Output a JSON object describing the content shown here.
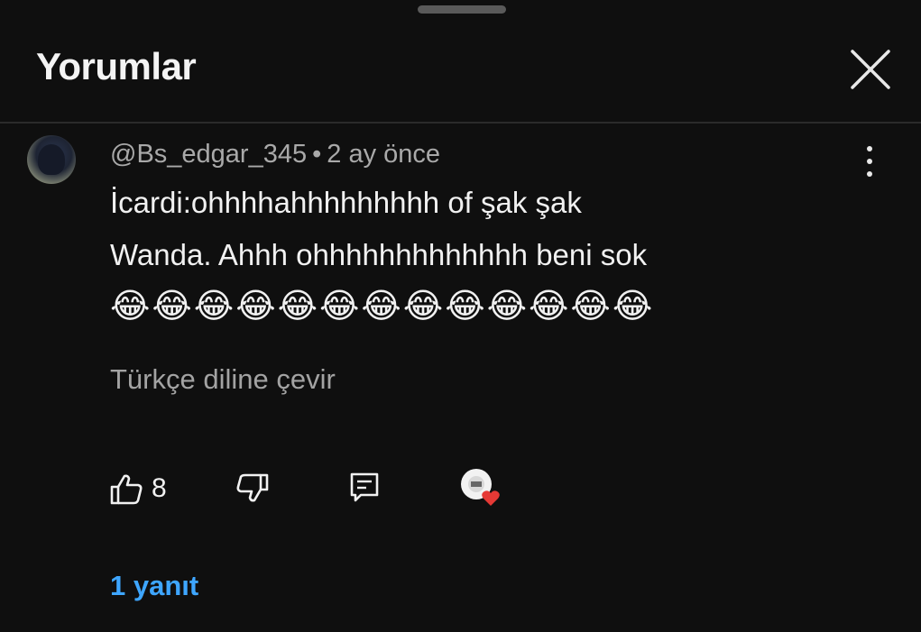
{
  "header": {
    "title": "Yorumlar",
    "close_icon": "close-icon"
  },
  "comment": {
    "author": "@Bs_edgar_345",
    "separator": "•",
    "time": "2 ay önce",
    "line1": "İcardi:ohhhhahhhhhhhhh of şak şak",
    "line2": "Wanda. Ahhh ohhhhhhhhhhhhh beni sok",
    "emojis": "😂😂😂😂😂😂😂😂😂😂😂😂😂",
    "translate_label": "Türkçe diline çevir",
    "like_count": "8",
    "replies_label": "1 yanıt"
  },
  "colors": {
    "background": "#0f0f0f",
    "text_primary": "#f1f1f1",
    "text_secondary": "#a9a9a9",
    "link_blue": "#3ea6ff",
    "heart_red": "#e53935"
  },
  "icons": [
    "close-icon",
    "more-vert-icon",
    "thumbs-up-icon",
    "thumbs-down-icon",
    "reply-icon",
    "creator-heart-icon"
  ]
}
